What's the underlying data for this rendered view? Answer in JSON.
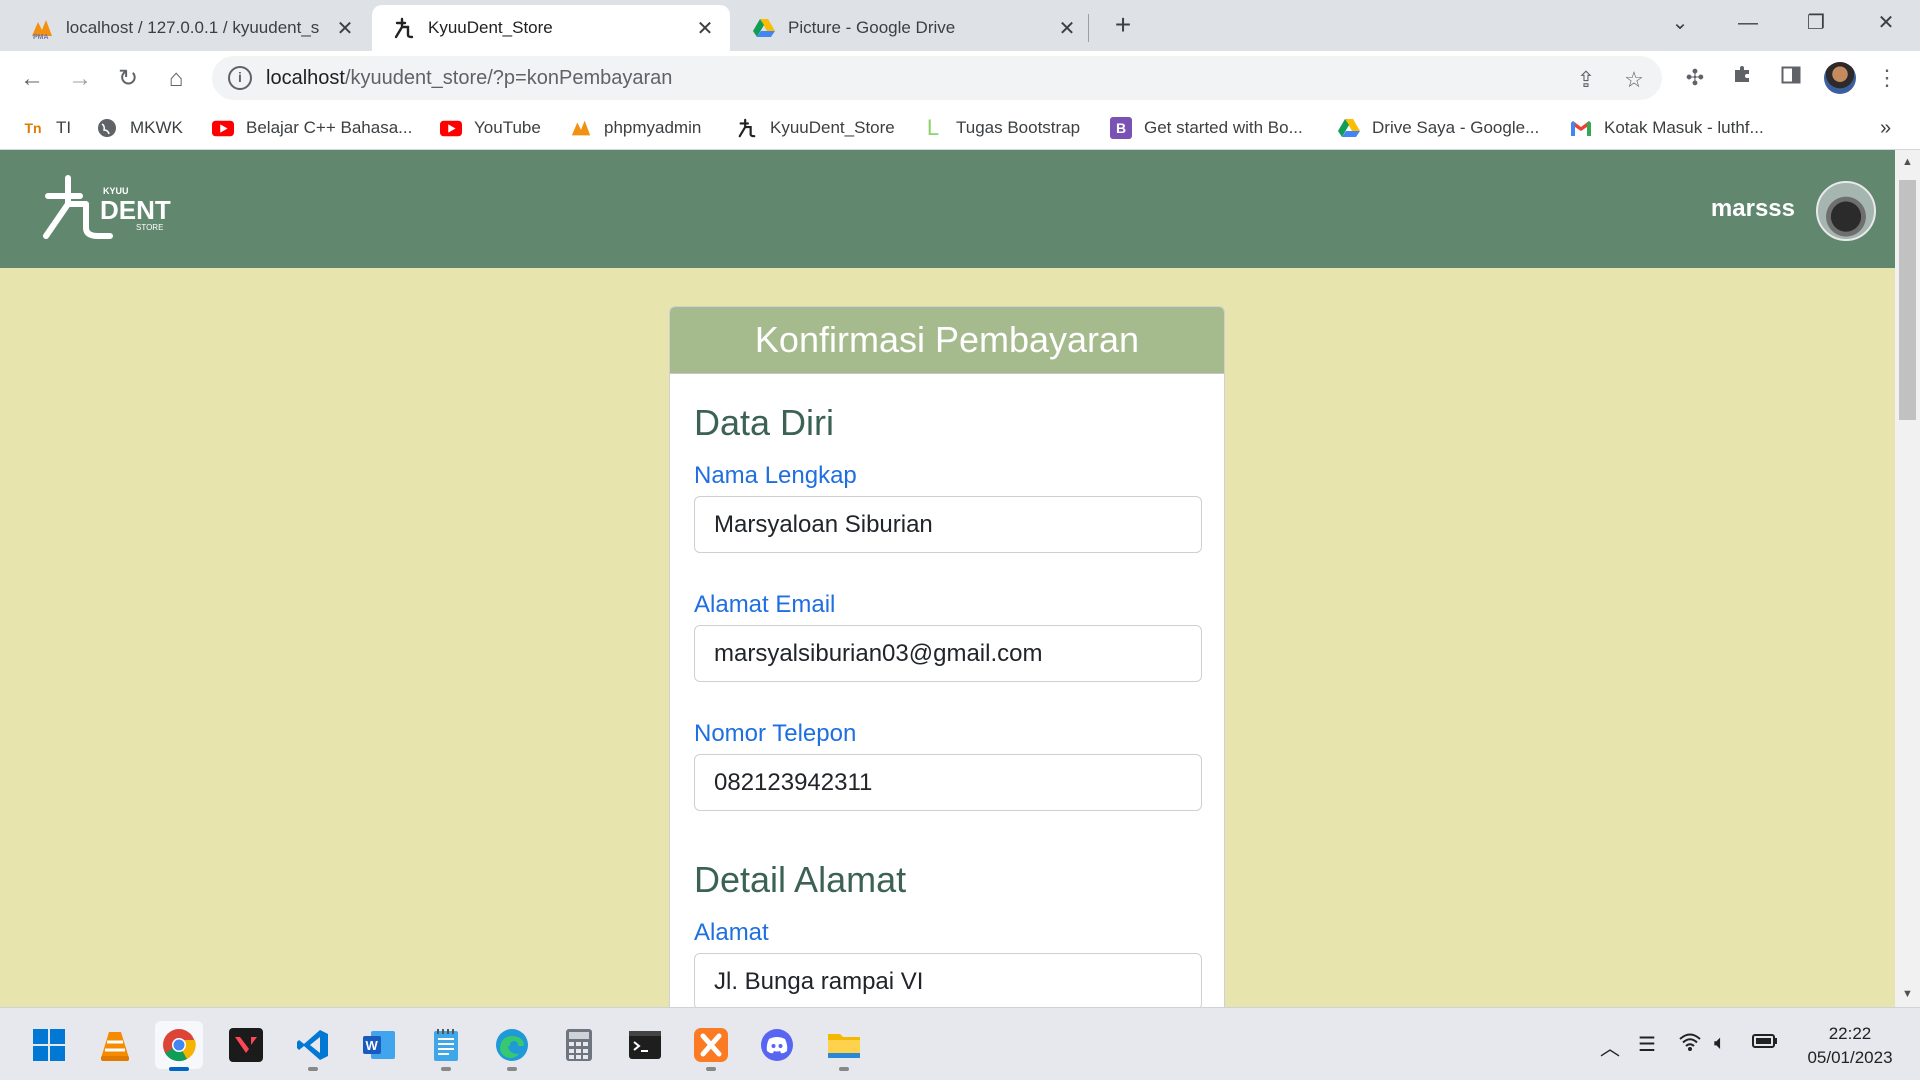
{
  "browser": {
    "tabs": [
      {
        "title": "localhost / 127.0.0.1 / kyuudent_s",
        "favicon": "phpmyadmin-icon",
        "active": false
      },
      {
        "title": "KyuuDent_Store",
        "favicon": "kyuudent-icon",
        "active": true
      },
      {
        "title": "Picture - Google Drive",
        "favicon": "google-drive-icon",
        "active": false
      }
    ],
    "url_host": "localhost",
    "url_path": "/kyuudent_store/?p=konPembayaran",
    "bookmarks": [
      {
        "label": "TI",
        "icon": "ti-icon"
      },
      {
        "label": "MKWK",
        "icon": "globe-icon"
      },
      {
        "label": "Belajar C++ Bahasa...",
        "icon": "youtube-icon"
      },
      {
        "label": "YouTube",
        "icon": "youtube-icon"
      },
      {
        "label": "phpmyadmin",
        "icon": "phpmyadmin-icon"
      },
      {
        "label": "KyuuDent_Store",
        "icon": "kyuudent-icon"
      },
      {
        "label": "Tugas Bootstrap",
        "icon": "bookmark-l-icon"
      },
      {
        "label": "Get started with Bo...",
        "icon": "bootstrap-icon"
      },
      {
        "label": "Drive Saya - Google...",
        "icon": "google-drive-icon"
      },
      {
        "label": "Kotak Masuk - luthf...",
        "icon": "gmail-icon"
      }
    ],
    "more_bookmarks": "»"
  },
  "site": {
    "logo_top": "KYUU",
    "logo_main": "DENT",
    "logo_sub": "STORE",
    "username": "marsss",
    "colors": {
      "navbar": "#61876e",
      "background": "#e8e4ae",
      "card_header": "#a6bb8d",
      "label": "#1f6fe0",
      "section_title": "#3c6255"
    }
  },
  "form": {
    "title": "Konfirmasi Pembayaran",
    "section_personal": "Data Diri",
    "name_label": "Nama Lengkap",
    "name_value": "Marsyaloan Siburian",
    "email_label": "Alamat Email",
    "email_value": "marsyalsiburian03@gmail.com",
    "phone_label": "Nomor Telepon",
    "phone_value": "082123942311",
    "section_address": "Detail Alamat",
    "address_label": "Alamat",
    "address_value": "Jl. Bunga rampai VI"
  },
  "taskbar": {
    "apps": [
      "windows-start-icon",
      "vlc-icon",
      "chrome-icon",
      "valorant-icon",
      "vscode-icon",
      "word-icon",
      "notepad-icon",
      "edge-icon",
      "calculator-icon",
      "terminal-icon",
      "xampp-icon",
      "discord-icon",
      "file-explorer-icon"
    ],
    "time": "22:22",
    "date": "05/01/2023"
  }
}
